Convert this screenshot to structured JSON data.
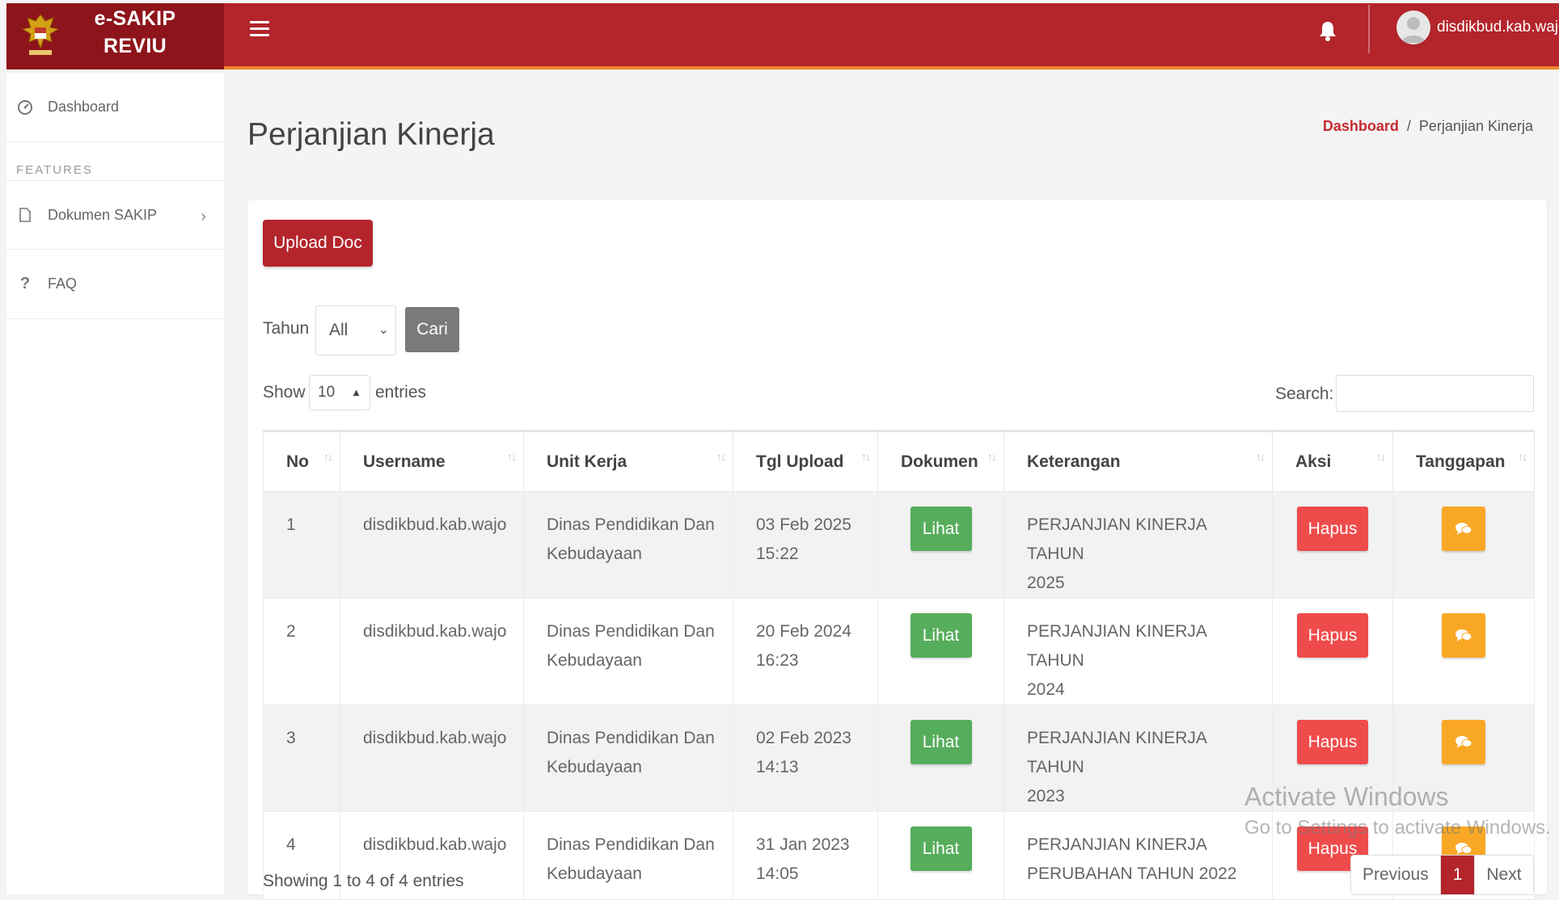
{
  "app": {
    "title_line1": "e-SAKIP",
    "title_line2": "REVIU",
    "user": "disdikbud.kab.wajo"
  },
  "colors": {
    "brand_dark": "#8e141b",
    "brand": "#b3242b",
    "accent_line": "#f0852c",
    "lihat": "#56ad5c",
    "hapus": "#f04b4b",
    "tanggapan": "#f9a825"
  },
  "sidebar": {
    "items": [
      {
        "label": "Dashboard",
        "icon": "dashboard-icon"
      },
      {
        "label": "Dokumen SAKIP",
        "icon": "document-icon"
      },
      {
        "label": "FAQ",
        "icon": "question-icon"
      }
    ],
    "section_label": "FEATURES"
  },
  "page": {
    "title": "Perjanjian Kinerja",
    "breadcrumb_home": "Dashboard",
    "breadcrumb_sep": "/",
    "breadcrumb_current": "Perjanjian Kinerja"
  },
  "filters": {
    "upload_label": "Upload Doc",
    "tahun_label": "Tahun",
    "tahun_value": "All",
    "cari_label": "Cari",
    "show_label": "Show",
    "show_value": "10",
    "entries_label": "entries",
    "search_label": "Search:",
    "search_value": ""
  },
  "table": {
    "columns": [
      "No",
      "Username",
      "Unit Kerja",
      "Tgl Upload",
      "Dokumen",
      "Keterangan",
      "Aksi",
      "Tanggapan"
    ],
    "lihat_label": "Lihat",
    "hapus_label": "Hapus",
    "rows": [
      {
        "no": "1",
        "username": "disdikbud.kab.wajo",
        "unit1": "Dinas Pendidikan Dan",
        "unit2": "Kebudayaan",
        "date": "03 Feb 2025",
        "time": "15:22",
        "ket1": "PERJANJIAN KINERJA TAHUN",
        "ket2": "2025"
      },
      {
        "no": "2",
        "username": "disdikbud.kab.wajo",
        "unit1": "Dinas Pendidikan Dan",
        "unit2": "Kebudayaan",
        "date": "20 Feb 2024",
        "time": "16:23",
        "ket1": "PERJANJIAN KINERJA TAHUN",
        "ket2": "2024"
      },
      {
        "no": "3",
        "username": "disdikbud.kab.wajo",
        "unit1": "Dinas Pendidikan Dan",
        "unit2": "Kebudayaan",
        "date": "02 Feb 2023",
        "time": "14:13",
        "ket1": "PERJANJIAN KINERJA TAHUN",
        "ket2": "2023"
      },
      {
        "no": "4",
        "username": "disdikbud.kab.wajo",
        "unit1": "Dinas Pendidikan Dan",
        "unit2": "Kebudayaan",
        "date": "31 Jan 2023",
        "time": "14:05",
        "ket1": "PERJANJIAN KINERJA",
        "ket2": "PERUBAHAN TAHUN 2022"
      }
    ]
  },
  "footer": {
    "info": "Showing 1 to 4 of 4 entries",
    "prev": "Previous",
    "page": "1",
    "next": "Next"
  },
  "watermark": {
    "line1": "Activate Windows",
    "line2": "Go to Settings to activate Windows."
  }
}
